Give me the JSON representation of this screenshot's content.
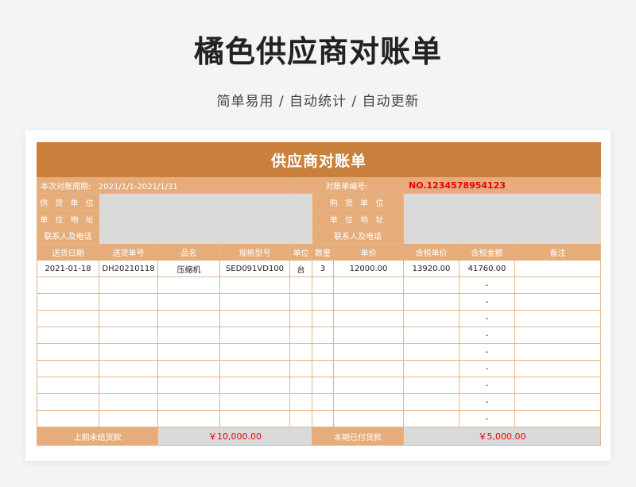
{
  "page": {
    "title": "橘色供应商对账单",
    "subtitle": "简单易用 / 自动统计 / 自动更新"
  },
  "sheet": {
    "banner": "供应商对账单",
    "period_label": "本次对账周期:",
    "period_value": "2021/1/1-2021/1/31",
    "statement_no_label": "对账单编号:",
    "statement_no_value": "NO.1234578954123",
    "info_left": [
      "供 货 单 位",
      "单 位 地 址",
      "联系人及电话"
    ],
    "info_right": [
      "购 货 单 位",
      "单 位 地 址",
      "联系人及电话"
    ],
    "headers": [
      "送货日期",
      "送货单号",
      "品名",
      "规格型号",
      "单位",
      "数量",
      "单价",
      "含税单价",
      "含税金额",
      "备注"
    ],
    "rows": [
      [
        "2021-01-18",
        "DH20210118",
        "压缩机",
        "SED091VD100",
        "台",
        "3",
        "12000.00",
        "13920.00",
        "41760.00",
        ""
      ],
      [
        "",
        "",
        "",
        "",
        "",
        "",
        "",
        "",
        "-",
        ""
      ],
      [
        "",
        "",
        "",
        "",
        "",
        "",
        "",
        "",
        "-",
        ""
      ],
      [
        "",
        "",
        "",
        "",
        "",
        "",
        "",
        "",
        "-",
        ""
      ],
      [
        "",
        "",
        "",
        "",
        "",
        "",
        "",
        "",
        "-",
        ""
      ],
      [
        "",
        "",
        "",
        "",
        "",
        "",
        "",
        "",
        "-",
        ""
      ],
      [
        "",
        "",
        "",
        "",
        "",
        "",
        "",
        "",
        "-",
        ""
      ],
      [
        "",
        "",
        "",
        "",
        "",
        "",
        "",
        "",
        "-",
        ""
      ],
      [
        "",
        "",
        "",
        "",
        "",
        "",
        "",
        "",
        "-",
        ""
      ],
      [
        "",
        "",
        "",
        "",
        "",
        "",
        "",
        "",
        "-",
        ""
      ]
    ],
    "footer": {
      "prev_unpaid_label": "上期未结货款",
      "prev_unpaid_value": "￥10,000.00",
      "paid_label": "本期已付货款",
      "paid_value": "￥5,000.00"
    }
  },
  "colors": {
    "banner": "#c9803d",
    "header": "#e6ad7a",
    "field": "#d9d9d9",
    "accent_red": "#e8000b"
  }
}
